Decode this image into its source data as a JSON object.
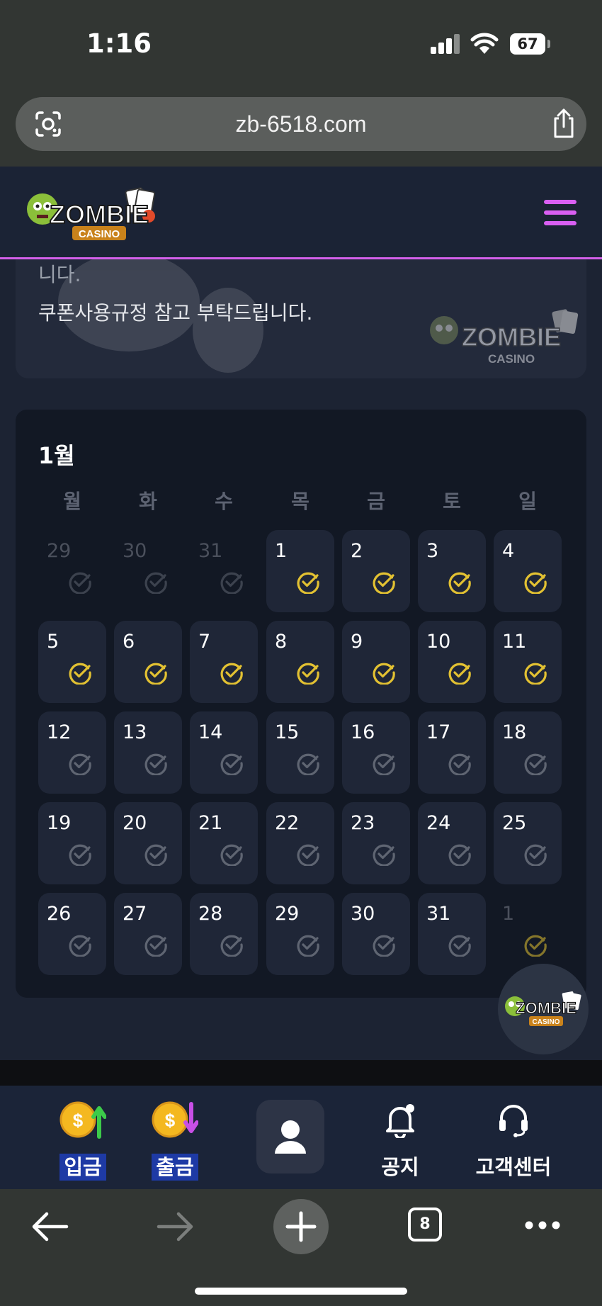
{
  "status": {
    "time": "1:16",
    "battery": "67"
  },
  "browser": {
    "url": "zb-6518.com",
    "tab_count": "8"
  },
  "site": {
    "logo_text": "ZOMBIE CASINO"
  },
  "notice": {
    "line1": "니다.",
    "line2": "쿠폰사용규정 참고 부탁드립니다."
  },
  "calendar": {
    "month": "1월",
    "weekdays": [
      "월",
      "화",
      "수",
      "목",
      "금",
      "토",
      "일"
    ],
    "days": [
      {
        "n": "29",
        "faded": true,
        "checked": false
      },
      {
        "n": "30",
        "faded": true,
        "checked": false
      },
      {
        "n": "31",
        "faded": true,
        "checked": false
      },
      {
        "n": "1",
        "faded": false,
        "checked": true
      },
      {
        "n": "2",
        "faded": false,
        "checked": true
      },
      {
        "n": "3",
        "faded": false,
        "checked": true
      },
      {
        "n": "4",
        "faded": false,
        "checked": true
      },
      {
        "n": "5",
        "faded": false,
        "checked": true
      },
      {
        "n": "6",
        "faded": false,
        "checked": true
      },
      {
        "n": "7",
        "faded": false,
        "checked": true
      },
      {
        "n": "8",
        "faded": false,
        "checked": true
      },
      {
        "n": "9",
        "faded": false,
        "checked": true
      },
      {
        "n": "10",
        "faded": false,
        "checked": true
      },
      {
        "n": "11",
        "faded": false,
        "checked": true
      },
      {
        "n": "12",
        "faded": false,
        "checked": false
      },
      {
        "n": "13",
        "faded": false,
        "checked": false
      },
      {
        "n": "14",
        "faded": false,
        "checked": false
      },
      {
        "n": "15",
        "faded": false,
        "checked": false
      },
      {
        "n": "16",
        "faded": false,
        "checked": false
      },
      {
        "n": "17",
        "faded": false,
        "checked": false
      },
      {
        "n": "18",
        "faded": false,
        "checked": false
      },
      {
        "n": "19",
        "faded": false,
        "checked": false
      },
      {
        "n": "20",
        "faded": false,
        "checked": false
      },
      {
        "n": "21",
        "faded": false,
        "checked": false
      },
      {
        "n": "22",
        "faded": false,
        "checked": false
      },
      {
        "n": "23",
        "faded": false,
        "checked": false
      },
      {
        "n": "24",
        "faded": false,
        "checked": false
      },
      {
        "n": "25",
        "faded": false,
        "checked": false
      },
      {
        "n": "26",
        "faded": false,
        "checked": false
      },
      {
        "n": "27",
        "faded": false,
        "checked": false
      },
      {
        "n": "28",
        "faded": false,
        "checked": false
      },
      {
        "n": "29",
        "faded": false,
        "checked": false
      },
      {
        "n": "30",
        "faded": false,
        "checked": false
      },
      {
        "n": "31",
        "faded": false,
        "checked": false
      },
      {
        "n": "1",
        "faded": true,
        "checked": true
      }
    ]
  },
  "bottom_nav": {
    "deposit": "입금",
    "withdraw": "출금",
    "notice": "공지",
    "support": "고객센터"
  },
  "colors": {
    "accent_purple": "#d95ff2",
    "check_yellow": "#e2c132",
    "check_grey": "#5f6572",
    "card_bg": "#1f2637"
  },
  "icons": [
    "lens-icon",
    "share-icon",
    "hamburger-icon",
    "check-circle-icon",
    "coin-up-icon",
    "coin-down-icon",
    "user-icon",
    "bell-icon",
    "headset-icon",
    "back-arrow-icon",
    "forward-arrow-icon",
    "plus-icon",
    "tabs-icon",
    "more-icon"
  ]
}
